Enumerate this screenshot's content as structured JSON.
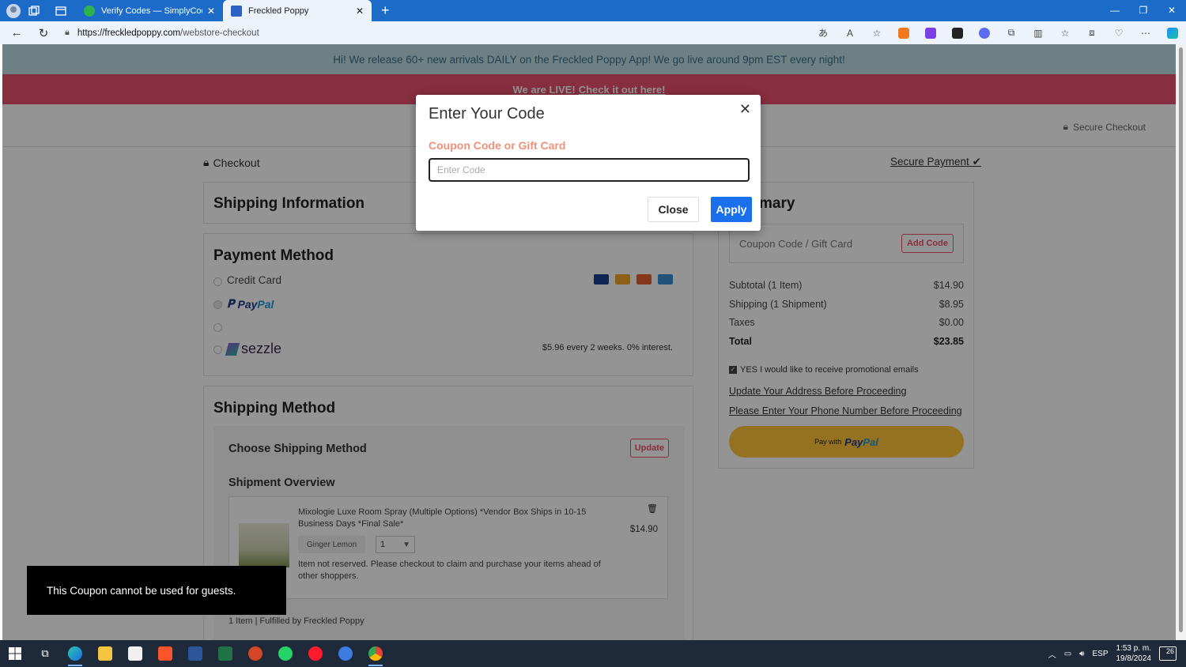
{
  "browser": {
    "tabs": [
      {
        "label": "Verify Codes — SimplyCodes",
        "active": false,
        "favicon_color": "#2fb24c"
      },
      {
        "label": "Freckled Poppy",
        "active": true,
        "favicon_color": "#2b62c4"
      }
    ],
    "url_host": "https://freckledpoppy.com",
    "url_path": "/webstore-checkout",
    "new_tab_icon": "plus-icon"
  },
  "page": {
    "banner_top": "Hi! We release 60+ new arrivals DAILY on the Freckled Poppy App! We go live around 9pm EST every night!",
    "banner_live_prefix": "We are LIVE!",
    "banner_live_link": "Check it out here!",
    "secure_checkout": "Secure Checkout",
    "checkout_label": "Checkout",
    "secure_payment": "Secure Payment",
    "shipping_info_title": "Shipping Information",
    "payment_method": {
      "title": "Payment Method",
      "credit_card": "Credit Card",
      "paypal_a": "Pay",
      "paypal_b": "Pal",
      "sezzle": "sezzle",
      "sezzle_terms": "$5.96 every 2 weeks. 0% interest."
    },
    "shipping_method": {
      "title": "Shipping Method",
      "choose": "Choose Shipping Method",
      "update_btn": "Update",
      "overview": "Shipment Overview",
      "item_title": "Mixologie Luxe Room Spray (Multiple Options) *Vendor Box Ships in 10-15 Business Days *Final Sale*",
      "variant": "Ginger Lemon",
      "qty": "1",
      "price": "$14.90",
      "not_reserved": "Item not reserved. Please checkout to claim and purchase your items ahead of other shoppers.",
      "fulfilled": "1 Item | Fulfilled by Freckled Poppy"
    },
    "summary": {
      "title_visible": "mary",
      "coupon_placeholder": "Coupon Code / Gift Card",
      "add_code": "Add Code",
      "rows": [
        {
          "label": "Subtotal (1 Item)",
          "value": "$14.90"
        },
        {
          "label": "Shipping (1 Shipment)",
          "value": "$8.95"
        },
        {
          "label": "Taxes",
          "value": "$0.00"
        },
        {
          "label": "Total",
          "value": "$23.85"
        }
      ],
      "promo": "YES I would like to receive promotional emails",
      "warn_address": "Update Your Address Before Proceeding",
      "warn_phone": "Please Enter Your Phone Number Before Proceeding",
      "paypal_btn_prefix": "Pay with",
      "paypal_btn_a": "Pay",
      "paypal_btn_b": "Pal"
    }
  },
  "modal": {
    "title": "Enter Your Code",
    "label": "Coupon Code or Gift Card",
    "input_placeholder": "Enter Code",
    "close_btn": "Close",
    "apply_btn": "Apply"
  },
  "toast": "This Coupon cannot be used for guests.",
  "taskbar": {
    "lang": "ESP",
    "time": "1:53 p. m.",
    "date": "19/8/2024",
    "notifications": "26"
  },
  "colors": {
    "accent_blue": "#1a70ea",
    "brand_pink": "#e9506e",
    "banner_blue": "#bcdfe6",
    "paypal_yellow": "#ffc439",
    "label_salmon": "#f0917b"
  }
}
